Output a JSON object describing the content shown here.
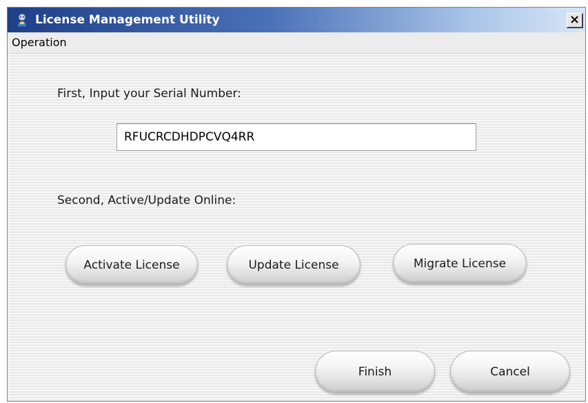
{
  "window": {
    "title": "License Management Utility",
    "close_label": "×"
  },
  "menu": {
    "items": [
      {
        "label": "Operation"
      }
    ]
  },
  "form": {
    "step1_label": "First, Input your Serial Number:",
    "serial_number": "RFUCRCDHDPCVQ4RR",
    "step2_label": "Second, Active/Update Online:"
  },
  "buttons": {
    "activate": "Activate License",
    "update": "Update License",
    "migrate": "Migrate License",
    "finish": "Finish",
    "cancel": "Cancel"
  },
  "colors": {
    "titlebar_start": "#1f3f88",
    "titlebar_end": "#d9e6f7",
    "background": "#f3f3f3"
  }
}
